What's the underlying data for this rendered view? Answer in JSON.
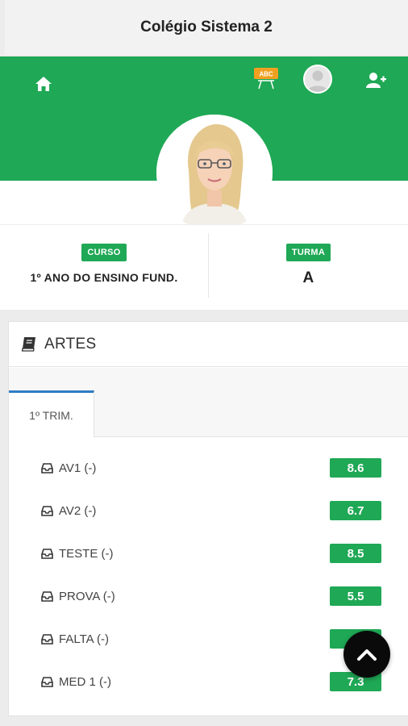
{
  "app": {
    "title": "Colégio Sistema 2"
  },
  "navbar": {
    "board_badge": "ABC"
  },
  "info": {
    "curso_label": "CURSO",
    "curso_value": "1º ANO DO ENSINO FUND.",
    "turma_label": "TURMA",
    "turma_value": "A"
  },
  "subject": {
    "name": "ARTES"
  },
  "tabs": [
    {
      "label": "1º TRIM."
    }
  ],
  "grades": [
    {
      "label": "AV1 (-)",
      "value": "8.6"
    },
    {
      "label": "AV2 (-)",
      "value": "6.7"
    },
    {
      "label": "TESTE (-)",
      "value": "8.5"
    },
    {
      "label": "PROVA (-)",
      "value": "5.5"
    },
    {
      "label": "FALTA (-)",
      "value": ""
    },
    {
      "label": "MED 1 (-)",
      "value": "7.3"
    }
  ],
  "colors": {
    "primary": "#1fa855",
    "tab_accent": "#2f7cc4",
    "badge_orange": "#f0a020",
    "fab": "#0a0a0a"
  }
}
